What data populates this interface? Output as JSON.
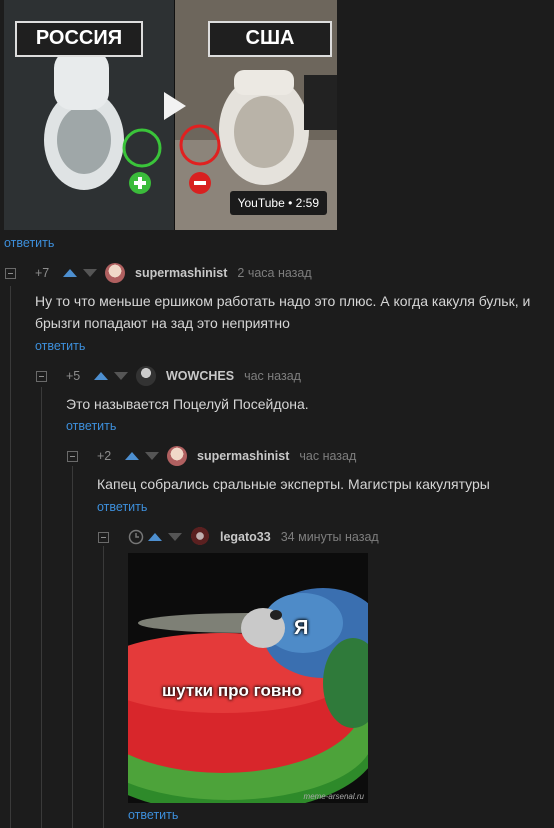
{
  "video": {
    "left_label": "РОССИЯ",
    "right_label": "США",
    "source": "YouTube",
    "duration": "2:59"
  },
  "reply_label": "ответить",
  "comments": [
    {
      "score": "+7",
      "user": "supermashinist",
      "time": "2 часа назад",
      "text_line1": "Ну то что меньше ершиком работать надо это плюс. А когда какуля бульк, и",
      "text_line2": "брызги попадают на зад это неприятно"
    },
    {
      "score": "+5",
      "user": "WOWCHES",
      "time": "час назад",
      "text": "Это называется Поцелуй Посейдона."
    },
    {
      "score": "+2",
      "user": "supermashinist",
      "time": "час назад",
      "text": "Капец собрались сральные эксперты. Магистры какулятуры"
    },
    {
      "user": "legato33",
      "time": "34 минуты назад",
      "meme": {
        "top_word": "Я",
        "caption": "шутки про говно",
        "watermark": "meme-arsenal.ru"
      }
    }
  ],
  "colors": {
    "background": "#1c1c1c",
    "link": "#3d8fdb",
    "upvote": "#4d8fd0"
  }
}
